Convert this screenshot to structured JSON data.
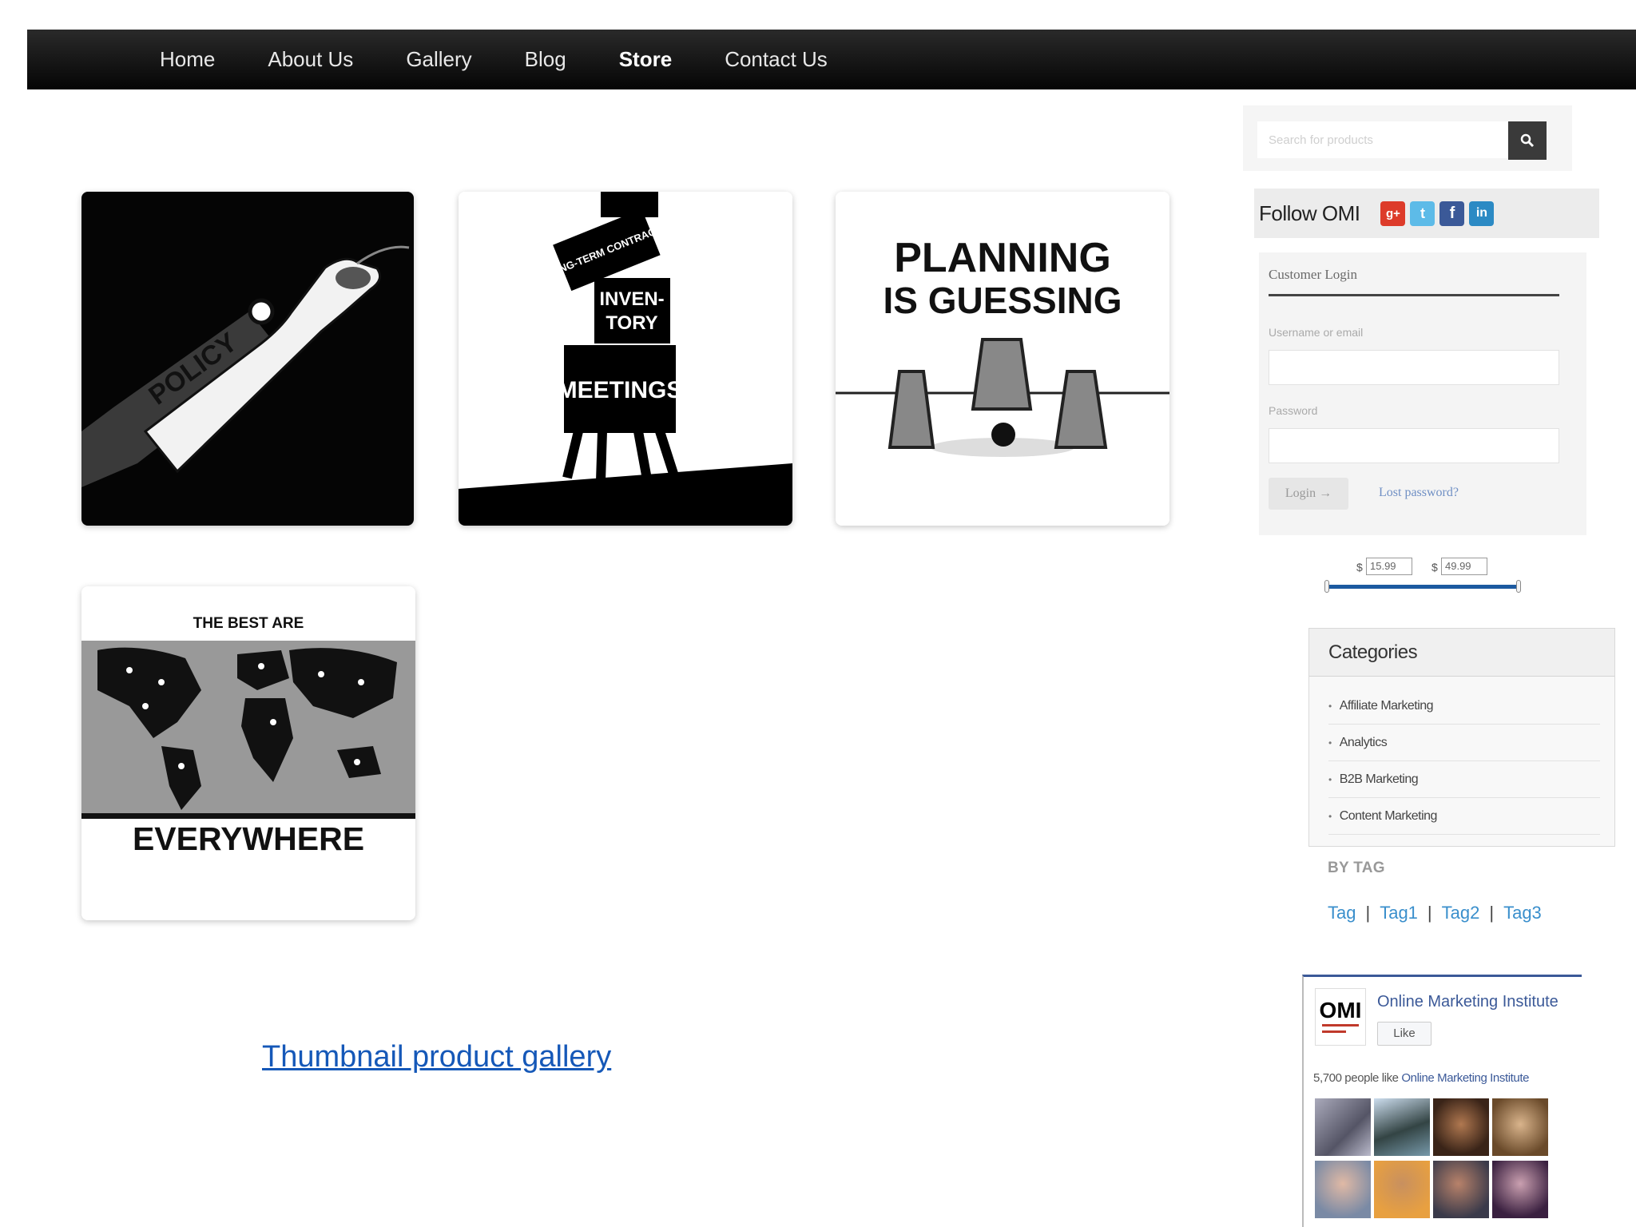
{
  "nav": {
    "items": [
      {
        "label": "Home"
      },
      {
        "label": "About Us"
      },
      {
        "label": "Gallery"
      },
      {
        "label": "Blog"
      },
      {
        "label": "Store",
        "active": true
      },
      {
        "label": "Contact Us"
      }
    ]
  },
  "products": [
    {
      "art": "policy",
      "text": "POLICY"
    },
    {
      "art": "stack",
      "labels": [
        "LONG-TERM CONTRACTS",
        "INVEN-",
        "TORY",
        "MEETINGS"
      ]
    },
    {
      "art": "cups",
      "line1": "PLANNING",
      "line2": "IS GUESSING"
    },
    {
      "art": "map",
      "top": "THE BEST ARE",
      "bottom": "EVERYWHERE"
    }
  ],
  "gallery_link": "Thumbnail product gallery",
  "search": {
    "placeholder": "Search for products",
    "icon": "search-icon"
  },
  "follow": {
    "label": "Follow OMI",
    "icons": [
      {
        "name": "google-plus-icon",
        "color": "#dd3b2a"
      },
      {
        "name": "twitter-icon",
        "color": "#5dbbe8"
      },
      {
        "name": "facebook-icon",
        "color": "#3b5998"
      },
      {
        "name": "linkedin-icon",
        "color": "#2c8ac4"
      }
    ]
  },
  "login": {
    "title": "Customer Login",
    "username_label": "Username or email",
    "password_label": "Password",
    "button": "Login →",
    "lost": "Lost password?"
  },
  "price": {
    "currency": "$",
    "min": "15.99",
    "max": "49.99"
  },
  "categories": {
    "title": "Categories",
    "items": [
      "Affiliate Marketing",
      "Analytics",
      "B2B Marketing",
      "Content Marketing"
    ]
  },
  "tags": {
    "label": "BY TAG",
    "items": [
      "Tag",
      "Tag1",
      "Tag2",
      "Tag3"
    ]
  },
  "facebook": {
    "page_name": "Online Marketing Institute",
    "like": "Like",
    "count_prefix": "5,700 people like",
    "count_page": "Online Marketing Institute",
    "logo_text": "OMI"
  }
}
